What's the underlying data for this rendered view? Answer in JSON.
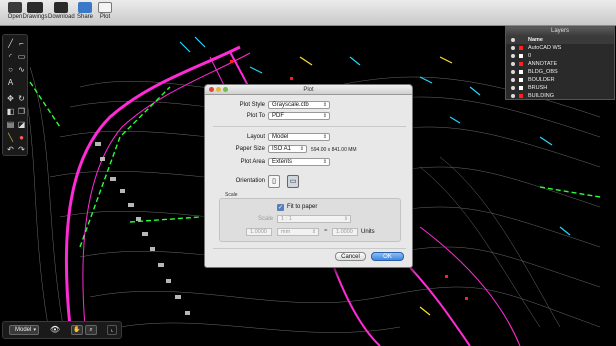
{
  "toolbar": {
    "items": [
      {
        "label": "Open",
        "icon": "folder-icon"
      },
      {
        "label": "Drawings",
        "icon": "drawings-icon"
      },
      {
        "label": "Download",
        "icon": "download-icon"
      },
      {
        "label": "Share",
        "icon": "share-icon"
      },
      {
        "label": "Plot",
        "icon": "plot-icon"
      }
    ]
  },
  "layers_panel": {
    "title": "Layers",
    "header": "Name",
    "items": [
      {
        "name": "AutoCAD WS",
        "color": "#ff2020"
      },
      {
        "name": "0",
        "color": "#ffffff"
      },
      {
        "name": "ANNOTATE",
        "color": "#ff2020"
      },
      {
        "name": "BLDG_OBS",
        "color": "#ffffff"
      },
      {
        "name": "BOULDER",
        "color": "#ffffff"
      },
      {
        "name": "BRUSH",
        "color": "#ffffff"
      },
      {
        "name": "BUILDING",
        "color": "#ff2020"
      }
    ]
  },
  "bottom": {
    "layout_select": "Model"
  },
  "plot_dialog": {
    "title": "Plot",
    "plot_style_label": "Plot Style",
    "plot_style_value": "Grayscale.ctb",
    "plot_to_label": "Plot To",
    "plot_to_value": "PDF",
    "layout_label": "Layout",
    "layout_value": "Model",
    "paper_size_label": "Paper Size",
    "paper_size_value": "ISO A1",
    "paper_size_dims": "594.00 x 841.00 MM",
    "plot_area_label": "Plot Area",
    "plot_area_value": "Extents",
    "orientation_label": "Orientation",
    "scale_section_label": "Scale",
    "fit_to_paper_label": "Fit to paper",
    "fit_to_paper_checked": true,
    "scale_label": "Scale",
    "scale_value": "1 : 1",
    "scale_left": "1.0000",
    "scale_unit": "mm",
    "scale_equals": "=",
    "scale_right": "1.0000",
    "units_label": "Units",
    "cancel_label": "Cancel",
    "ok_label": "OK"
  },
  "colors": {
    "accent": "#3d87e0",
    "drawing_magenta": "#ff2bd6",
    "drawing_green": "#2bff3a",
    "drawing_cyan": "#25d6ff",
    "drawing_yellow": "#ffe02b"
  }
}
